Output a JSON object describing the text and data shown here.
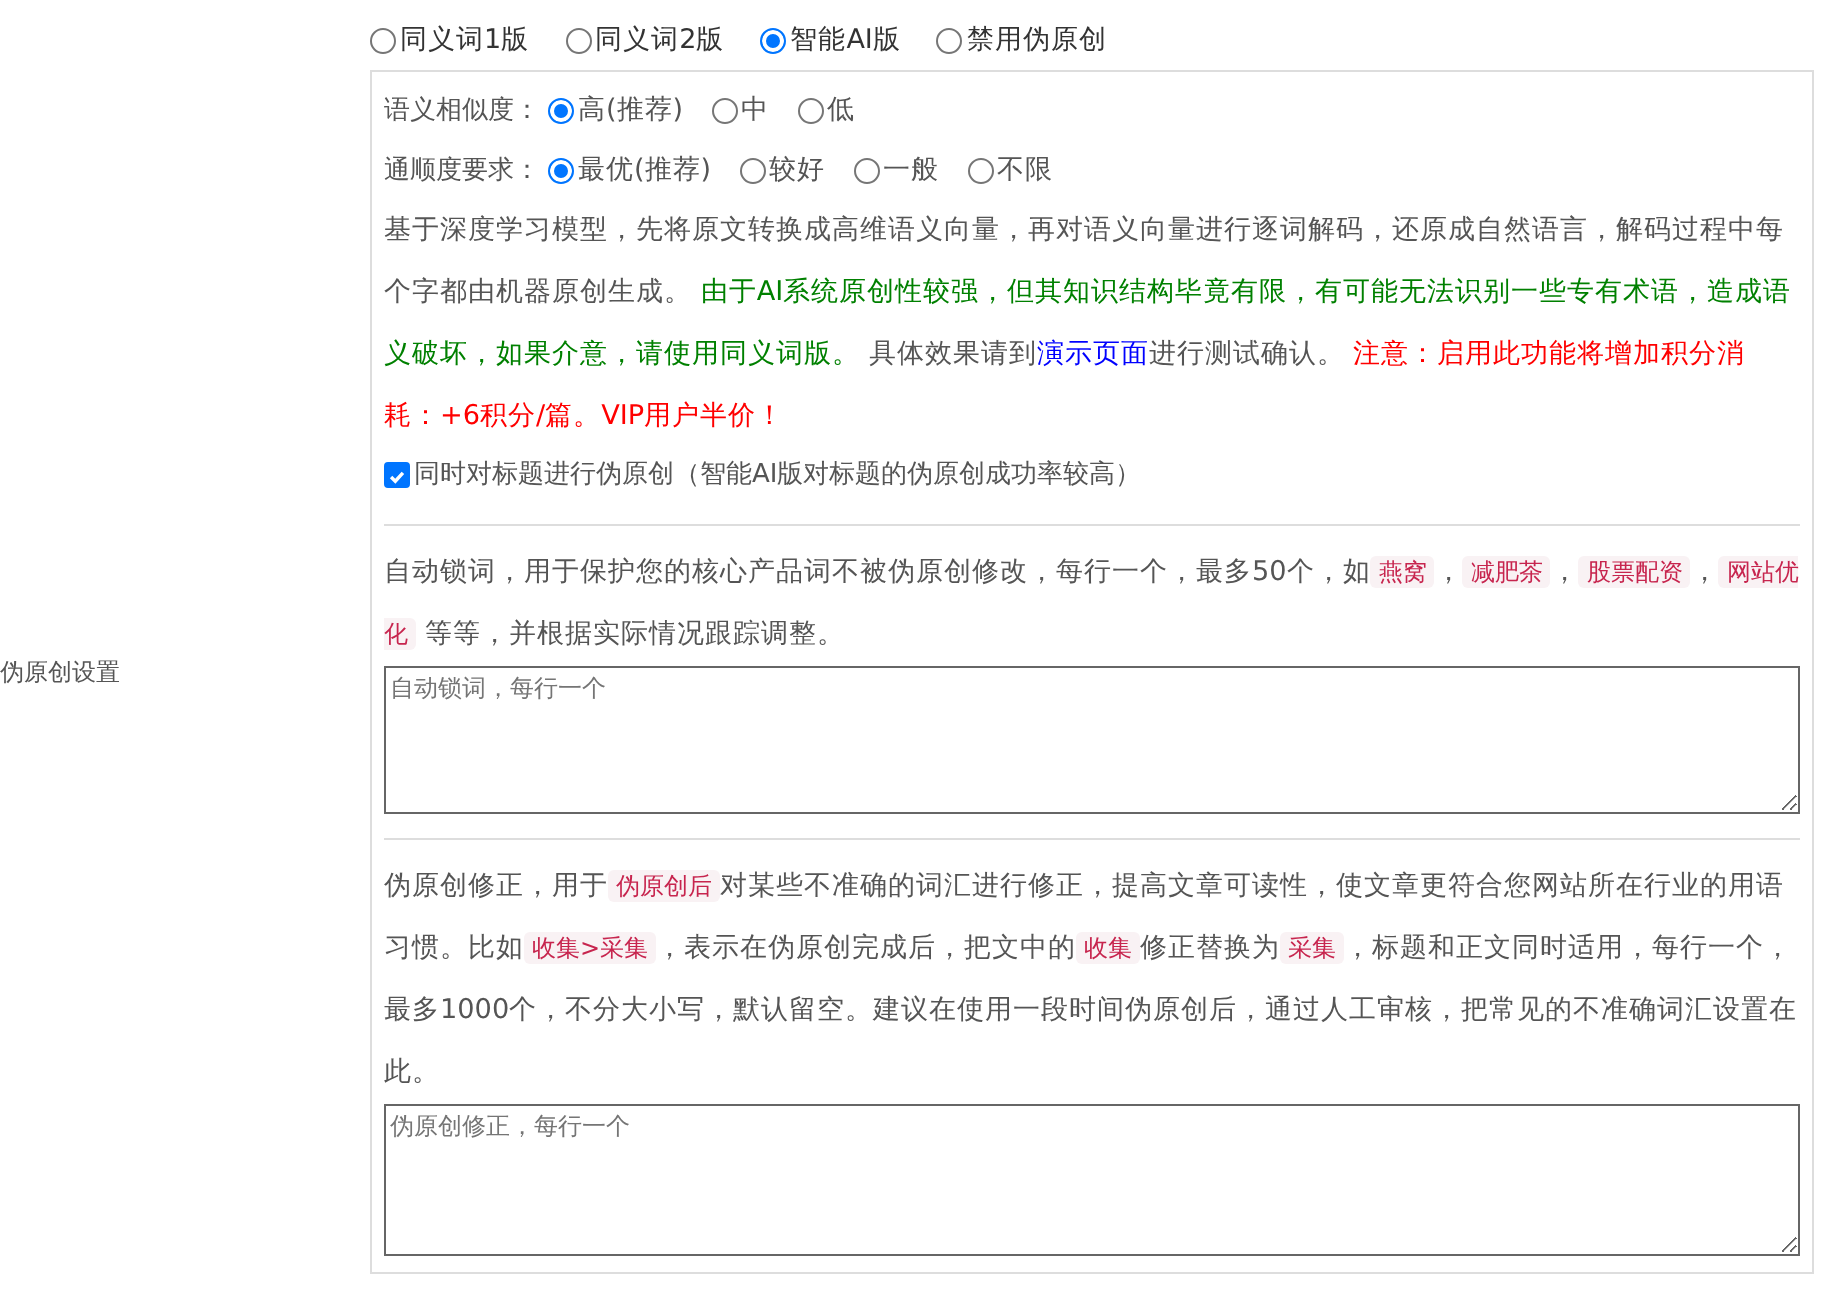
{
  "modes": [
    {
      "label": "同义词1版",
      "selected": false
    },
    {
      "label": "同义词2版",
      "selected": false
    },
    {
      "label": "智能AI版",
      "selected": true
    },
    {
      "label": "禁用伪原创",
      "selected": false
    }
  ],
  "section_label": "伪原创设置",
  "similarity": {
    "label": "语义相似度：",
    "options": [
      {
        "label": "高(推荐)",
        "selected": true
      },
      {
        "label": "中",
        "selected": false
      },
      {
        "label": "低",
        "selected": false
      }
    ]
  },
  "fluency": {
    "label": "通顺度要求：",
    "options": [
      {
        "label": "最优(推荐)",
        "selected": true
      },
      {
        "label": "较好",
        "selected": false
      },
      {
        "label": "一般",
        "selected": false
      },
      {
        "label": "不限",
        "selected": false
      }
    ]
  },
  "description": [
    {
      "kind": "plain",
      "text": "基于深度学习模型，先将原文转换成高维语义向量，再对语义向量进行逐词解码，还原成自然语言，解码过程中每个字都由机器原创生成。 "
    },
    {
      "kind": "green",
      "text": "由于AI系统原创性较强，但其知识结构毕竟有限，有可能无法识别一些专有术语，造成语义破坏，如果介意，请使用同义词版。"
    },
    {
      "kind": "plain",
      "text": " 具体效果请到"
    },
    {
      "kind": "link",
      "text": "演示页面"
    },
    {
      "kind": "plain",
      "text": "进行测试确认。 "
    },
    {
      "kind": "red",
      "text": "注意：启用此功能将增加积分消耗：+6积分/篇。VIP用户半价！"
    }
  ],
  "title_checkbox": {
    "label": "同时对标题进行伪原创（智能AI版对标题的伪原创成功率较高）",
    "checked": true
  },
  "lock_words": {
    "description": [
      {
        "kind": "plain",
        "text": "自动锁词，用于保护您的核心产品词不被伪原创修改，每行一个，最多50个，如"
      },
      {
        "kind": "tag",
        "text": "燕窝"
      },
      {
        "kind": "plain",
        "text": "，"
      },
      {
        "kind": "tag",
        "text": "减肥茶"
      },
      {
        "kind": "plain",
        "text": "，"
      },
      {
        "kind": "tag",
        "text": "股票配资"
      },
      {
        "kind": "plain",
        "text": "，"
      },
      {
        "kind": "tag",
        "text": "网站优化"
      },
      {
        "kind": "plain",
        "text": " 等等，并根据实际情况跟踪调整。"
      }
    ],
    "placeholder": "自动锁词，每行一个"
  },
  "corrections": {
    "description": [
      {
        "kind": "plain",
        "text": "伪原创修正，用于"
      },
      {
        "kind": "tag",
        "text": "伪原创后"
      },
      {
        "kind": "plain",
        "text": "对某些不准确的词汇进行修正，提高文章可读性，使文章更符合您网站所在行业的用语习惯。比如"
      },
      {
        "kind": "tag",
        "text": "收集>采集"
      },
      {
        "kind": "plain",
        "text": "，表示在伪原创完成后，把文中的"
      },
      {
        "kind": "tag",
        "text": "收集"
      },
      {
        "kind": "plain",
        "text": "修正替换为"
      },
      {
        "kind": "tag",
        "text": "采集"
      },
      {
        "kind": "plain",
        "text": "，标题和正文同时适用，每行一个，最多1000个，不分大小写，默认留空。建议在使用一段时间伪原创后，通过人工审核，把常见的不准确词汇设置在此。"
      }
    ],
    "placeholder": "伪原创修正，每行一个"
  }
}
